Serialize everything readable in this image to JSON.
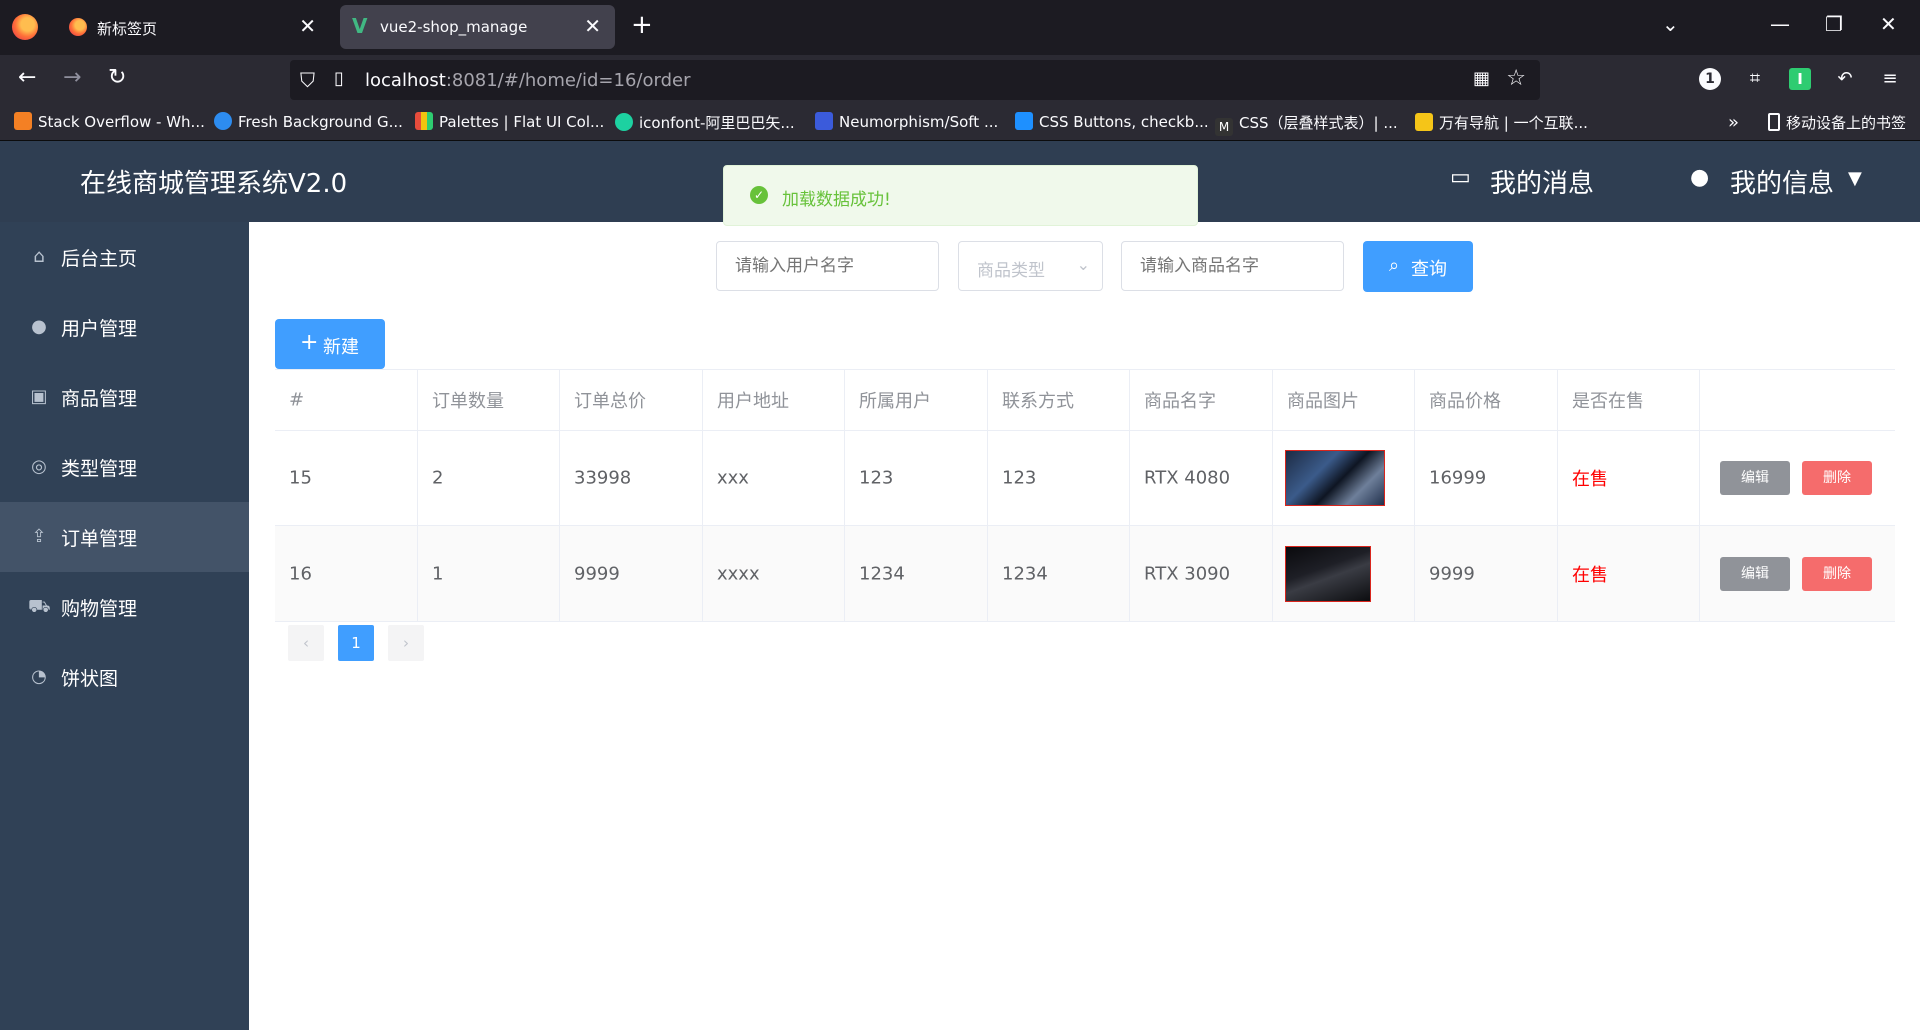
{
  "browser": {
    "tabs": [
      {
        "title": "新标签页",
        "close": "✕"
      },
      {
        "title": "vue2-shop_manage",
        "close": "✕"
      }
    ],
    "new_tab": "+",
    "url_host": "localhost",
    "url_rest": ":8081/#/home/id=16/order",
    "bookmarks": [
      {
        "label": "Stack Overflow - Wh...",
        "color": "#f48024"
      },
      {
        "label": "Fresh Background G...",
        "color": "#2d8cf0"
      },
      {
        "label": "Palettes | Flat UI Col...",
        "color": "#e74c3c"
      },
      {
        "label": "iconfont-阿里巴巴矢...",
        "color": "#1dd1a1"
      },
      {
        "label": "Neumorphism/Soft ...",
        "color": "#3b5bdb"
      },
      {
        "label": "CSS Buttons, checkb...",
        "color": "#1e90ff"
      },
      {
        "label": "CSS（层叠样式表）| ...",
        "color": "#333333"
      },
      {
        "label": "万有导航 | 一个互联...",
        "color": "#f5c518"
      }
    ],
    "mobile_bookmarks": "移动设备上的书签"
  },
  "app": {
    "title": "在线商城管理系统V2.0",
    "messages": "我的消息",
    "profile": "我的信息"
  },
  "sidebar": {
    "items": [
      {
        "label": "后台主页",
        "icon": "home-icon",
        "active": false
      },
      {
        "label": "用户管理",
        "icon": "user-icon",
        "active": false
      },
      {
        "label": "商品管理",
        "icon": "goods-icon",
        "active": false
      },
      {
        "label": "类型管理",
        "icon": "category-icon",
        "active": false
      },
      {
        "label": "订单管理",
        "icon": "order-icon",
        "active": true
      },
      {
        "label": "购物管理",
        "icon": "cart-icon",
        "active": false
      },
      {
        "label": "饼状图",
        "icon": "pie-chart-icon",
        "active": false
      }
    ]
  },
  "toast": {
    "text": "加载数据成功!",
    "color": "#67c23a"
  },
  "search": {
    "user_placeholder": "请输入用户名字",
    "type_placeholder": "商品类型",
    "goods_placeholder": "请输入商品名字",
    "query_label": "查询"
  },
  "new_button": "新建",
  "table": {
    "headers": [
      "#",
      "订单数量",
      "订单总价",
      "用户地址",
      "所属用户",
      "联系方式",
      "商品名字",
      "商品图片",
      "商品价格",
      "是否在售",
      ""
    ],
    "rows": [
      {
        "id": "15",
        "qty": "2",
        "total": "33998",
        "address": "xxx",
        "user": "123",
        "contact": "123",
        "name": "RTX 4080",
        "price": "16999",
        "status": "在售"
      },
      {
        "id": "16",
        "qty": "1",
        "total": "9999",
        "address": "xxxx",
        "user": "1234",
        "contact": "1234",
        "name": "RTX 3090",
        "price": "9999",
        "status": "在售"
      }
    ],
    "edit_label": "编辑",
    "delete_label": "删除"
  },
  "pagination": {
    "current": "1",
    "prev": "‹",
    "next": "›"
  },
  "colors": {
    "primary": "#409eff",
    "danger": "#f56c6c",
    "header_bg": "#2f3e52",
    "sidebar_bg": "#304156"
  }
}
